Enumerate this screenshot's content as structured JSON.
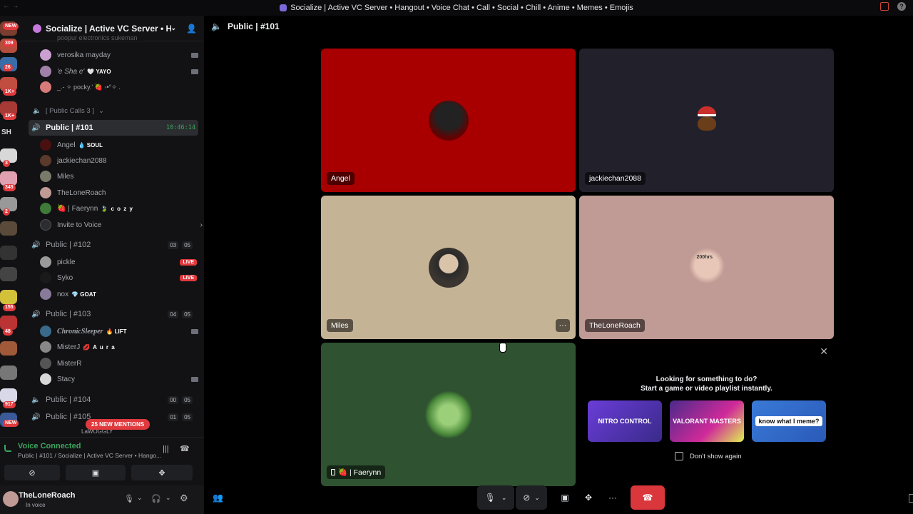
{
  "window": {
    "title": "Socialize | Active VC Server • Hangout • Voice Chat • Call • Social • Chill • Anime • Memes • Emojis",
    "nav_arrows": "← →"
  },
  "guilds": {
    "badges": [
      "NEW",
      "309",
      "26",
      "1K+",
      "1K+",
      "SH",
      "3",
      "345",
      "2",
      "155",
      "48",
      "917",
      "NEW"
    ]
  },
  "server": {
    "name": "Socialize | Active VC Server • Han...",
    "clipped_user": "poopur electronics sukeman"
  },
  "sidebar": {
    "top_users": [
      {
        "name": "verosika mayday",
        "badge": ""
      },
      {
        "name": "'e Sha e'",
        "badge": "🤍 YAYO"
      },
      {
        "name": "_.- ✧ pocky.' 🍓 ◦•°✧ ."
      }
    ],
    "category": "[ Public Calls 3 ]",
    "channels": [
      {
        "name": "Public | #101",
        "timer": "10:46:14"
      },
      {
        "name": "Public | #102",
        "count": "03",
        "limit": "05"
      },
      {
        "name": "Public | #103",
        "count": "04",
        "limit": "05"
      },
      {
        "name": "Public | #104",
        "count": "00",
        "limit": "05"
      },
      {
        "name": "Public | #105",
        "count": "01",
        "limit": "05"
      }
    ],
    "ch101_users": [
      {
        "name": "Angel",
        "badge": "💧 SOUL"
      },
      {
        "name": "jackiechan2088"
      },
      {
        "name": "Miles"
      },
      {
        "name": "TheLoneRoach"
      },
      {
        "name": "🍓 | Faerynn",
        "badge": "🍃 c o z y"
      }
    ],
    "invite": "Invite to Voice",
    "ch102_users": [
      {
        "name": "pickle",
        "live": "LIVE"
      },
      {
        "name": "Syko",
        "live": "LIVE"
      },
      {
        "name": "nox",
        "badge": "💎 GOAT"
      }
    ],
    "ch103_users": [
      {
        "name": "ChronicSleeper",
        "badge": "🔥 LIFT"
      },
      {
        "name": "MisterJ",
        "badge": "💋 A u r a"
      },
      {
        "name": "MisterR"
      },
      {
        "name": "Stacy"
      }
    ],
    "ch105_clipped": "LaWOGGLY",
    "mentions": "25 NEW MENTIONS"
  },
  "voice": {
    "status": "Voice Connected",
    "location": "Public | #101 / Socialize | Active VC Server • Hango..."
  },
  "user": {
    "name": "TheLoneRoach",
    "status": "In voice"
  },
  "channel_header": "Public | #101",
  "tiles": [
    {
      "name": "Angel",
      "bg": "#a80000"
    },
    {
      "name": "jackiechan2088",
      "bg": "#22212b"
    },
    {
      "name": "Miles",
      "bg": "#c5b396"
    },
    {
      "name": "TheLoneRoach",
      "bg": "#c09a94"
    },
    {
      "name": "🍓 | Faerynn",
      "bg": "#2f5231"
    }
  ],
  "activity": {
    "line1": "Looking for something to do?",
    "line2": "Start a game or video playlist instantly.",
    "cards": [
      "NITRO CONTROL",
      "VALORANT MASTERS",
      "know what I meme?"
    ],
    "checkbox": "Don't show again"
  },
  "avatars": {
    "miles_badge": "200hrs"
  },
  "colors": {
    "connected": "#3ba55d",
    "danger": "#da373c",
    "mention": "#e03a3e"
  }
}
